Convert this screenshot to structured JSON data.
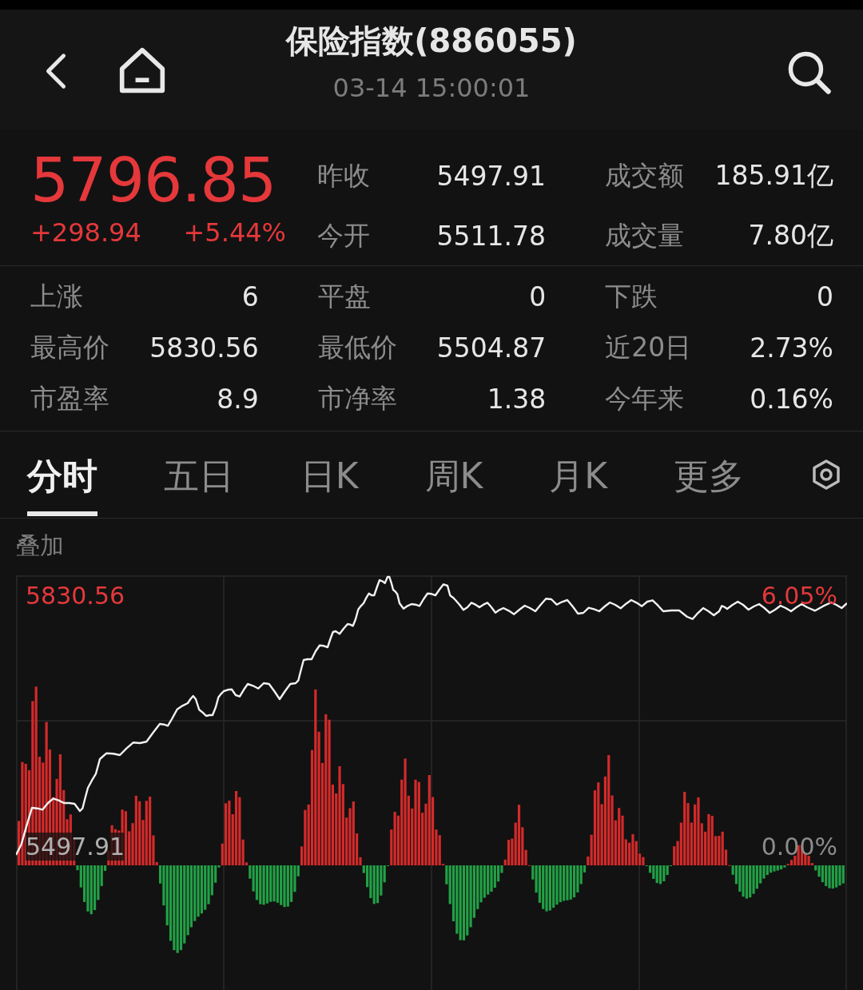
{
  "header": {
    "title": "保险指数(886055)",
    "time": "03-14 15:00:01"
  },
  "quote": {
    "price": "5796.85",
    "change": "+298.94",
    "change_pct": "+5.44%",
    "stats": [
      {
        "label": "昨收",
        "value": "5497.91"
      },
      {
        "label": "成交额",
        "value": "185.91亿"
      },
      {
        "label": "今开",
        "value": "5511.78"
      },
      {
        "label": "成交量",
        "value": "7.80亿"
      }
    ]
  },
  "stats": [
    {
      "label": "上涨",
      "value": "6"
    },
    {
      "label": "平盘",
      "value": "0"
    },
    {
      "label": "下跌",
      "value": "0"
    },
    {
      "label": "最高价",
      "value": "5830.56"
    },
    {
      "label": "最低价",
      "value": "5504.87"
    },
    {
      "label": "近20日",
      "value": "2.73%"
    },
    {
      "label": "市盈率",
      "value": "8.9"
    },
    {
      "label": "市净率",
      "value": "1.38"
    },
    {
      "label": "今年来",
      "value": "0.16%"
    }
  ],
  "tabs": [
    {
      "label": "分时",
      "selected": true
    },
    {
      "label": "五日",
      "selected": false
    },
    {
      "label": "日K",
      "selected": false
    },
    {
      "label": "周K",
      "selected": false
    },
    {
      "label": "月K",
      "selected": false
    },
    {
      "label": "更多",
      "selected": false
    }
  ],
  "overlay_label": "叠加",
  "chart": {
    "high_price": "5830.56",
    "high_pct": "6.05%",
    "base_price": "5497.91",
    "base_pct": "0.00%"
  }
}
